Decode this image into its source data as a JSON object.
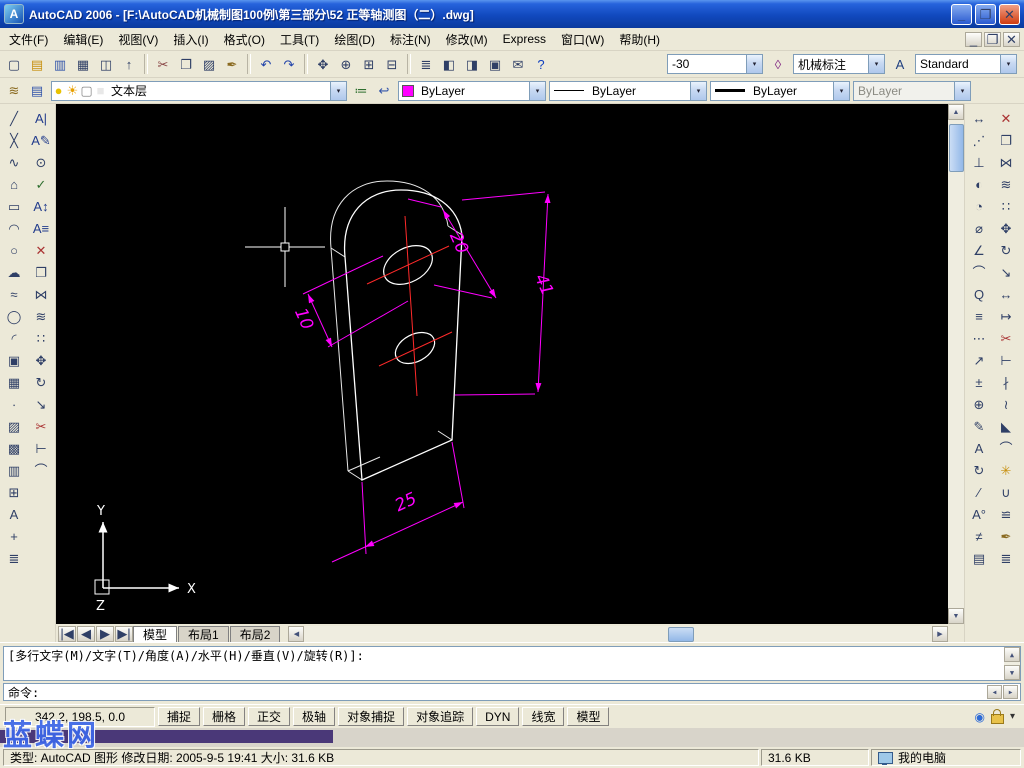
{
  "window": {
    "app_icon": "A",
    "title": "AutoCAD 2006 - [F:\\AutoCAD机械制图100例\\第三部分\\52 正等轴测图（二）.dwg]",
    "controls": [
      {
        "name": "minimize",
        "glyph": "_",
        "cls": "min"
      },
      {
        "name": "maximize",
        "glyph": "❐",
        "cls": "min"
      },
      {
        "name": "close",
        "glyph": "✕",
        "cls": "close"
      }
    ],
    "mdi_controls": [
      {
        "name": "mdi-minimize",
        "glyph": "_"
      },
      {
        "name": "mdi-restore",
        "glyph": "❐"
      },
      {
        "name": "mdi-close",
        "glyph": "✕"
      }
    ]
  },
  "menu": {
    "items": [
      {
        "name": "file",
        "label": "文件(F)"
      },
      {
        "name": "edit",
        "label": "编辑(E)"
      },
      {
        "name": "view",
        "label": "视图(V)"
      },
      {
        "name": "insert",
        "label": "插入(I)"
      },
      {
        "name": "format",
        "label": "格式(O)"
      },
      {
        "name": "tools",
        "label": "工具(T)"
      },
      {
        "name": "draw",
        "label": "绘图(D)"
      },
      {
        "name": "dimension",
        "label": "标注(N)"
      },
      {
        "name": "modify",
        "label": "修改(M)"
      },
      {
        "name": "express",
        "label": "Express"
      },
      {
        "name": "window",
        "label": "窗口(W)"
      },
      {
        "name": "help",
        "label": "帮助(H)"
      }
    ]
  },
  "icons": {
    "dropdown": "▾",
    "scroll_up": "▲",
    "scroll_down": "▼",
    "scroll_left": "◀",
    "scroll_right": "▶",
    "comm": "◉"
  },
  "toolbar_standard": {
    "icons": [
      {
        "name": "new-file",
        "glyph": "▢"
      },
      {
        "name": "open-file",
        "glyph": "▤",
        "color": "#C89010"
      },
      {
        "name": "save-file",
        "glyph": "▥",
        "color": "#3355AA"
      },
      {
        "name": "plot",
        "glyph": "▦"
      },
      {
        "name": "plot-preview",
        "glyph": "◫"
      },
      {
        "name": "publish",
        "glyph": "↑"
      },
      {
        "sep": true
      },
      {
        "name": "cut",
        "glyph": "✂",
        "color": "#884444"
      },
      {
        "name": "copy-clip",
        "glyph": "❐"
      },
      {
        "name": "paste",
        "glyph": "▨"
      },
      {
        "name": "match-properties",
        "glyph": "✒",
        "color": "#8A6A20"
      },
      {
        "sep": true
      },
      {
        "name": "undo",
        "glyph": "↶",
        "color": "#2244AA"
      },
      {
        "name": "redo",
        "glyph": "↷",
        "color": "#2244AA"
      },
      {
        "sep": true
      },
      {
        "name": "pan",
        "glyph": "✥"
      },
      {
        "name": "zoom-realtime",
        "glyph": "⊕"
      },
      {
        "name": "zoom-window",
        "glyph": "⊞"
      },
      {
        "name": "zoom-previous",
        "glyph": "⊟"
      },
      {
        "sep": true
      },
      {
        "name": "properties",
        "glyph": "≣"
      },
      {
        "name": "designcenter",
        "glyph": "◧"
      },
      {
        "name": "tool-palettes",
        "glyph": "◨"
      },
      {
        "name": "sheet-set-manager",
        "glyph": "▣"
      },
      {
        "name": "markup-set-manager",
        "glyph": "✉"
      },
      {
        "name": "help",
        "glyph": "?",
        "color": "#1040C0"
      }
    ],
    "angle": "-30",
    "mid_icons": [
      {
        "name": "dim-style-manager",
        "glyph": "◊",
        "color": "#883388"
      }
    ],
    "dim_style": "机械标注",
    "mid_icons2": [
      {
        "name": "text-style-manager",
        "glyph": "A",
        "color": "#204080"
      }
    ],
    "text_style": "Standard"
  },
  "toolbar_properties": {
    "left_icons": [
      {
        "name": "layer-properties-manager",
        "glyph": "≋",
        "color": "#8A6A20"
      },
      {
        "name": "layers",
        "glyph": "▤",
        "color": "#3355AA"
      }
    ],
    "layer_status": [
      {
        "name": "layer-on",
        "glyph": "●",
        "color": "#E8C200"
      },
      {
        "name": "layer-thaw",
        "glyph": "☀",
        "color": "#E8A000"
      },
      {
        "name": "layer-unlock",
        "glyph": "▢",
        "color": "#888888"
      },
      {
        "name": "layer-color",
        "glyph": "■",
        "color": "#E8E8E8"
      }
    ],
    "layer_name": "文本层",
    "after_layer_icons": [
      {
        "name": "make-object-layer-current",
        "glyph": "≔",
        "color": "#2F6F2F"
      },
      {
        "name": "layer-previous",
        "glyph": "↩",
        "color": "#3355AA"
      }
    ],
    "color_value": "ByLayer",
    "color_swatch": "#FF00FF",
    "linetype_value": "ByLayer",
    "lineweight_value": "ByLayer",
    "plotstyle_value": "ByLayer"
  },
  "toolbars_left": {
    "col1": [
      {
        "name": "line",
        "glyph": "╱"
      },
      {
        "name": "construction-line",
        "glyph": "╳"
      },
      {
        "name": "polyline",
        "glyph": "∿"
      },
      {
        "name": "polygon",
        "glyph": "⌂"
      },
      {
        "name": "rectangle",
        "glyph": "▭"
      },
      {
        "name": "arc",
        "glyph": "◠"
      },
      {
        "name": "circle",
        "glyph": "○"
      },
      {
        "name": "revision-cloud",
        "glyph": "☁"
      },
      {
        "name": "spline",
        "glyph": "≈"
      },
      {
        "name": "ellipse",
        "glyph": "◯"
      },
      {
        "name": "ellipse-arc",
        "glyph": "◜"
      },
      {
        "name": "insert-block",
        "glyph": "▣"
      },
      {
        "name": "make-block",
        "glyph": "▦"
      },
      {
        "name": "point",
        "glyph": "∙"
      },
      {
        "name": "hatch",
        "glyph": "▨"
      },
      {
        "name": "gradient",
        "glyph": "▩"
      },
      {
        "name": "region",
        "glyph": "▥"
      },
      {
        "name": "table",
        "glyph": "⊞"
      },
      {
        "name": "multiline-text",
        "glyph": "A"
      },
      {
        "name": "measure",
        "glyph": "+"
      },
      {
        "name": "list",
        "glyph": "≣"
      }
    ],
    "col2": [
      {
        "name": "single-line-text",
        "glyph": "A|",
        "color": "#223C8C"
      },
      {
        "name": "edit-text",
        "glyph": "A✎",
        "color": "#223C8C"
      },
      {
        "name": "find",
        "glyph": "⊙"
      },
      {
        "name": "spell-check",
        "glyph": "✓",
        "color": "#2F6F2F"
      },
      {
        "name": "scale-text",
        "glyph": "A↕",
        "color": "#223C8C"
      },
      {
        "name": "justify-text",
        "glyph": "A≡",
        "color": "#223C8C"
      },
      {
        "name": "erase",
        "glyph": "✕",
        "color": "#AA3333"
      },
      {
        "name": "copy-object",
        "glyph": "❐"
      },
      {
        "name": "mirror",
        "glyph": "⋈"
      },
      {
        "name": "offset",
        "glyph": "≋"
      },
      {
        "name": "array",
        "glyph": "∷"
      },
      {
        "name": "move",
        "glyph": "✥"
      },
      {
        "name": "rotate",
        "glyph": "↻"
      },
      {
        "name": "scale",
        "glyph": "↘"
      },
      {
        "name": "trim",
        "glyph": "✂",
        "color": "#AA3333"
      },
      {
        "name": "extend",
        "glyph": "⊢"
      },
      {
        "name": "fillet",
        "glyph": "⌒"
      }
    ]
  },
  "toolbars_right": {
    "col1": [
      {
        "name": "dim-linear",
        "glyph": "↔"
      },
      {
        "name": "dim-aligned",
        "glyph": "⋰"
      },
      {
        "name": "dim-ordinate",
        "glyph": "⊥"
      },
      {
        "name": "dim-radius",
        "glyph": "◐"
      },
      {
        "name": "dim-jogged",
        "glyph": "◔"
      },
      {
        "name": "dim-diameter",
        "glyph": "⌀"
      },
      {
        "name": "dim-angular",
        "glyph": "∠"
      },
      {
        "name": "dim-arc-length",
        "glyph": "⌒"
      },
      {
        "name": "quick-dimension",
        "glyph": "Q"
      },
      {
        "name": "dim-baseline",
        "glyph": "≡"
      },
      {
        "name": "dim-continue",
        "glyph": "⋯"
      },
      {
        "name": "quick-leader",
        "glyph": "↗"
      },
      {
        "name": "tolerance",
        "glyph": "±"
      },
      {
        "name": "center-mark",
        "glyph": "⊕"
      },
      {
        "name": "dim-edit",
        "glyph": "✎"
      },
      {
        "name": "dim-text-edit",
        "glyph": "A"
      },
      {
        "name": "dim-update",
        "glyph": "↻"
      },
      {
        "name": "dim-oblique",
        "glyph": "∕"
      },
      {
        "name": "dim-text-angle",
        "glyph": "A°"
      },
      {
        "name": "dim-break",
        "glyph": "≠"
      },
      {
        "name": "dim-style",
        "glyph": "▤"
      }
    ],
    "col2": [
      {
        "name": "erase",
        "glyph": "✕",
        "color": "#AA3333"
      },
      {
        "name": "copy",
        "glyph": "❐"
      },
      {
        "name": "mirror",
        "glyph": "⋈"
      },
      {
        "name": "offset",
        "glyph": "≋"
      },
      {
        "name": "array",
        "glyph": "∷"
      },
      {
        "name": "move",
        "glyph": "✥"
      },
      {
        "name": "rotate",
        "glyph": "↻"
      },
      {
        "name": "scale",
        "glyph": "↘"
      },
      {
        "name": "stretch",
        "glyph": "↔"
      },
      {
        "name": "lengthen",
        "glyph": "↦"
      },
      {
        "name": "trim",
        "glyph": "✂",
        "color": "#AA3333"
      },
      {
        "name": "extend",
        "glyph": "⊢"
      },
      {
        "name": "break-at-point",
        "glyph": "∤"
      },
      {
        "name": "break",
        "glyph": "≀"
      },
      {
        "name": "chamfer",
        "glyph": "◣"
      },
      {
        "name": "fillet",
        "glyph": "⌒"
      },
      {
        "name": "explode",
        "glyph": "✳",
        "color": "#C89010"
      },
      {
        "name": "join",
        "glyph": "∪"
      },
      {
        "name": "align",
        "glyph": "≌"
      },
      {
        "name": "match",
        "glyph": "✒",
        "color": "#8A6A20"
      },
      {
        "name": "properties",
        "glyph": "≣"
      }
    ]
  },
  "canvas": {
    "dims": {
      "d10": "10",
      "d20": "20",
      "d41": "41",
      "d25": "25"
    },
    "ucs": {
      "x": "X",
      "y": "Y",
      "z": "Z"
    }
  },
  "tabs": {
    "nav": [
      {
        "name": "first",
        "glyph": "|◀"
      },
      {
        "name": "prev",
        "glyph": "◀"
      },
      {
        "name": "next",
        "glyph": "▶"
      },
      {
        "name": "last",
        "glyph": "▶|"
      }
    ],
    "items": [
      {
        "name": "model",
        "label": "模型",
        "active": true
      },
      {
        "name": "layout1",
        "label": "布局1"
      },
      {
        "name": "layout2",
        "label": "布局2"
      }
    ]
  },
  "command": {
    "history_line": "[多行文字(M)/文字(T)/角度(A)/水平(H)/垂直(V)/旋转(R)]:",
    "history_line2": "",
    "prompt": "命令:"
  },
  "status": {
    "coords": "342.2, 198.5, 0.0",
    "toggles": [
      {
        "name": "snap",
        "label": "捕捉"
      },
      {
        "name": "grid",
        "label": "栅格"
      },
      {
        "name": "ortho",
        "label": "正交"
      },
      {
        "name": "polar",
        "label": "极轴"
      },
      {
        "name": "osnap",
        "label": "对象捕捉"
      },
      {
        "name": "otrack",
        "label": "对象追踪"
      },
      {
        "name": "dyn",
        "label": "DYN"
      },
      {
        "name": "lwt",
        "label": "线宽"
      },
      {
        "name": "model",
        "label": "模型"
      }
    ]
  },
  "explorer": {
    "info": "类型: AutoCAD 图形  修改日期: 2005-9-5 19:41  大小: 31.6 KB",
    "size": "31.6 KB",
    "location": "我的电脑"
  },
  "watermark": {
    "text": "蓝蝶网"
  }
}
